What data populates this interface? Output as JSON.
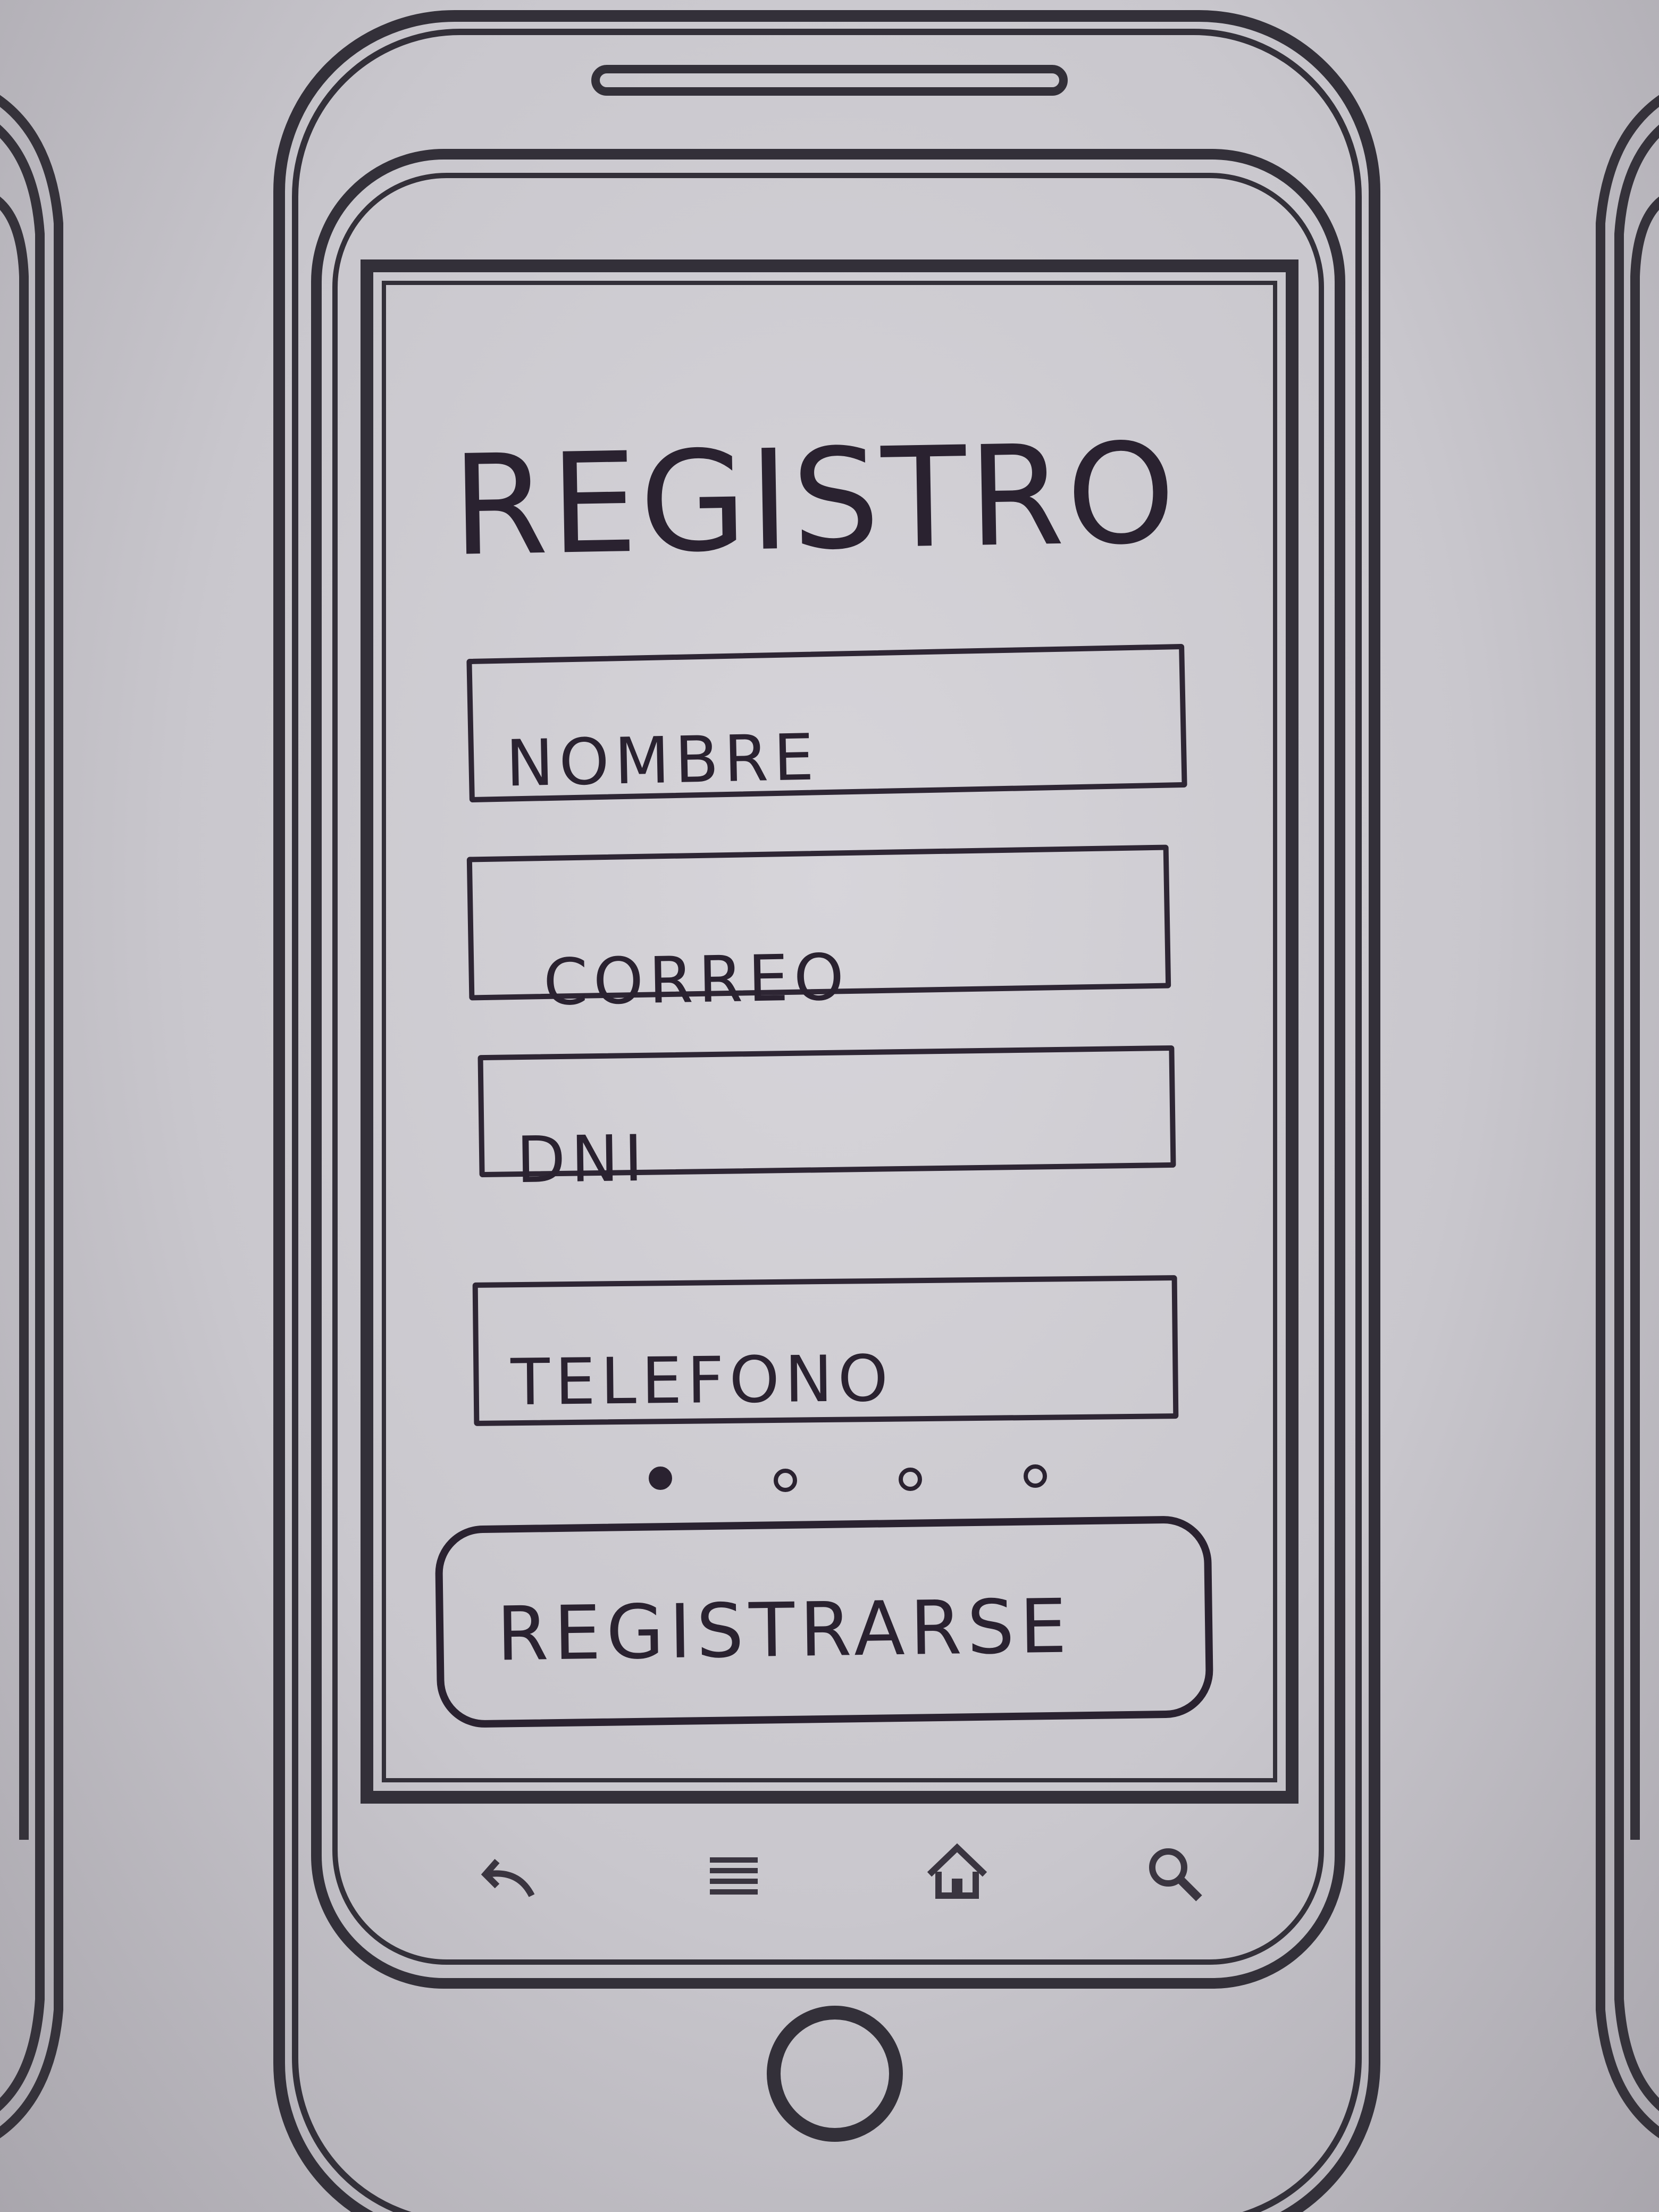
{
  "screen": {
    "title": "REGISTRO"
  },
  "form": {
    "fields": [
      {
        "label": "NOMBRE"
      },
      {
        "label": "CORREO"
      },
      {
        "label": "DNI"
      },
      {
        "label": "TELEFONO"
      }
    ]
  },
  "pager": {
    "total": 4,
    "active_index": 0
  },
  "actions": {
    "register_label": "REGISTRARSE"
  },
  "navbar": {
    "icons": [
      "back-icon",
      "menu-icon",
      "home-icon",
      "search-icon"
    ]
  },
  "colors": {
    "ink": "#2a2230",
    "device_outline": "#333039",
    "paper": "#cfcdd2"
  }
}
